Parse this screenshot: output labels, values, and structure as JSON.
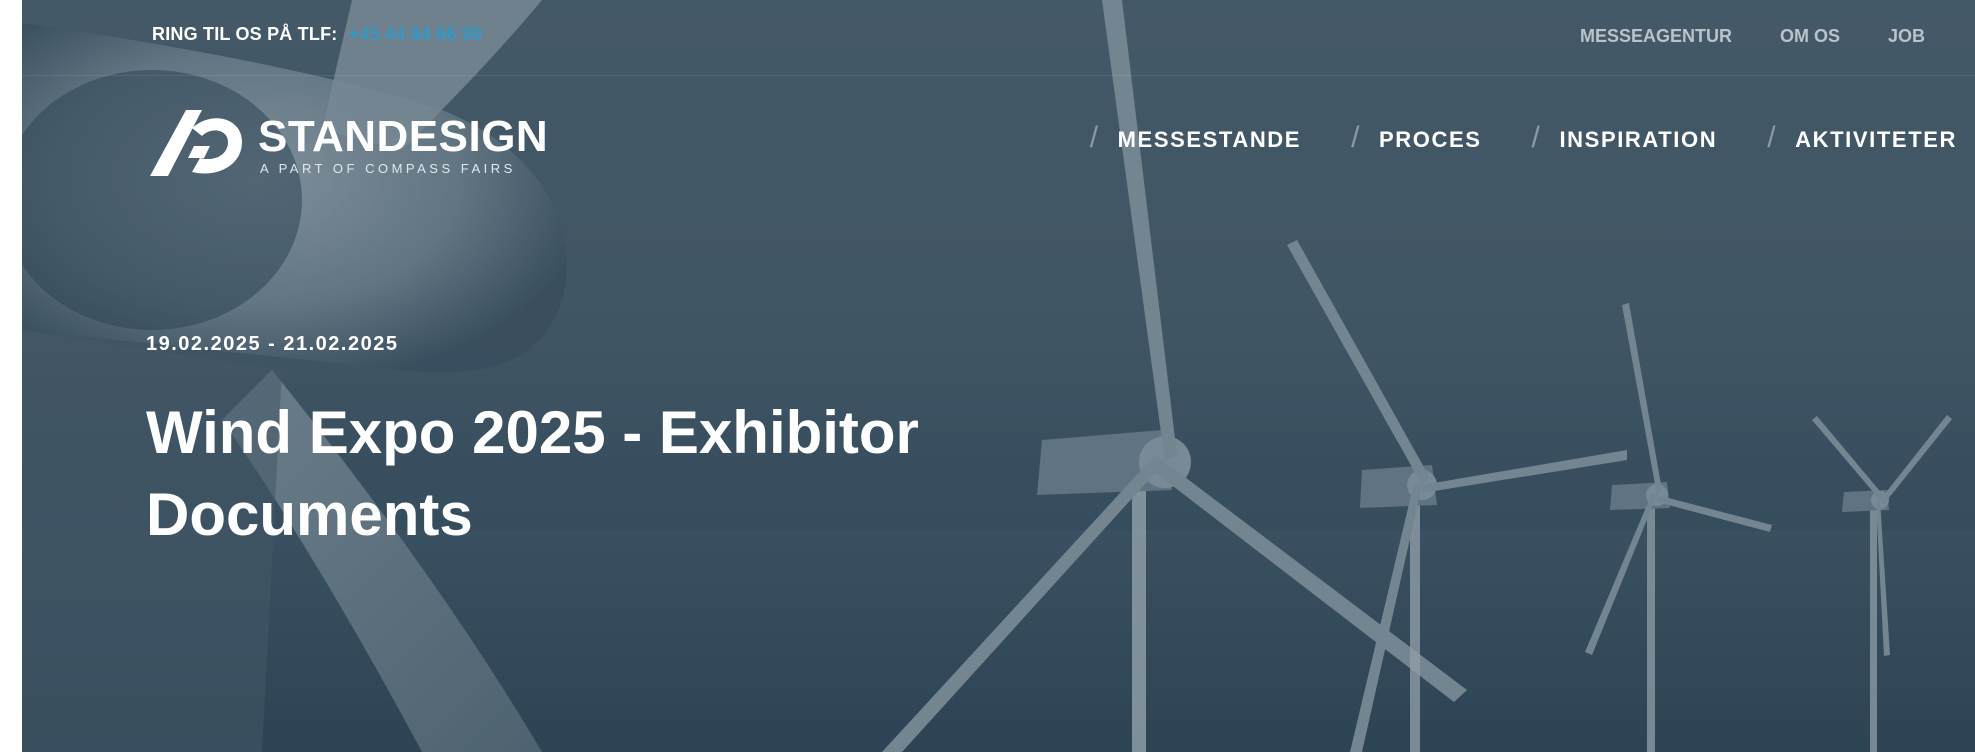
{
  "topbar": {
    "phone_label": "RING TIL OS PÅ TLF:",
    "phone_number": "+45 44 84 66 99",
    "links": [
      "MESSEAGENTUR",
      "OM OS",
      "JOB"
    ]
  },
  "logo": {
    "name": "STANDESIGN",
    "tagline": "A PART OF COMPASS FAIRS"
  },
  "mainnav": {
    "items": [
      "MESSESTANDE",
      "PROCES",
      "INSPIRATION",
      "AKTIVITETER"
    ]
  },
  "event": {
    "date": "19.02.2025 - 21.02.2025",
    "title": "Wind Expo 2025 - Exhibitor Documents"
  },
  "colors": {
    "phone_accent": "#1aa3dd",
    "hero_overlay": "#465a68"
  }
}
